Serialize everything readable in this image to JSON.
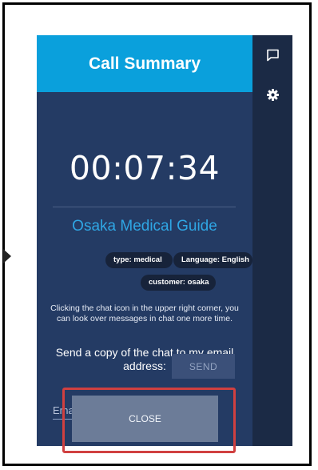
{
  "summary": {
    "title": "Call Summary",
    "duration": "00:07:34",
    "guide_name": "Osaka Medical Guide",
    "tags": {
      "type": "type: medical",
      "language": "Language: English",
      "customer": "customer: osaka"
    },
    "hint": "Clicking the chat icon in the upper right corner, you can look over messages in chat one more time.",
    "send_copy": "Send a copy of the chat to my email address:",
    "email": {
      "placeholder": "Email address *",
      "value": ""
    },
    "send_label": "SEND",
    "close_label": "CLOSE"
  },
  "rail": {
    "icons": [
      "chat-icon",
      "gear-icon"
    ]
  },
  "colors": {
    "header": "#0aa0dc",
    "panel": "#243b64",
    "rail": "#1b2a45",
    "accent_text": "#2fa6e4",
    "tag": "#17233a",
    "close_button": "#6c7c98",
    "highlight": "#d04040"
  }
}
